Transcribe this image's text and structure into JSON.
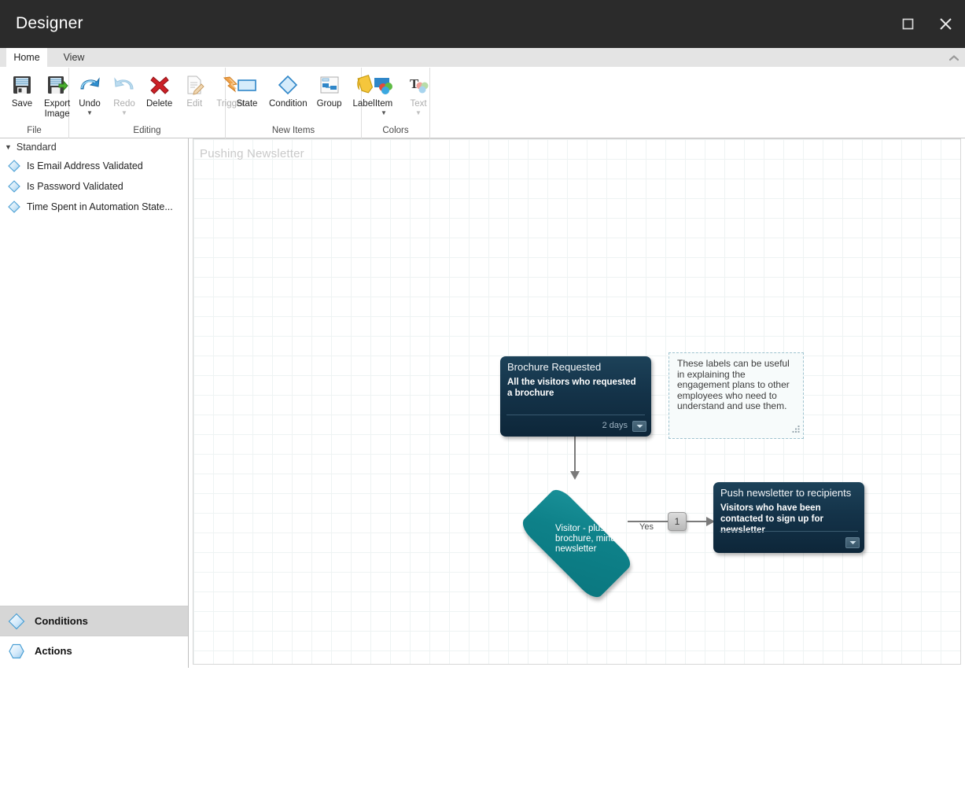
{
  "window": {
    "title": "Designer",
    "maximize_icon": "maximize-icon",
    "close_icon": "close-icon"
  },
  "ribbon": {
    "tabs": [
      {
        "label": "Home",
        "active": true
      },
      {
        "label": "View",
        "active": false
      }
    ],
    "collapse_icon": "chevron-up-icon",
    "groups": [
      {
        "name": "File",
        "label": "File",
        "items": [
          {
            "label": "Save",
            "icon": "floppy-disk-icon",
            "disabled": false,
            "has_caret": false
          },
          {
            "label": "Export\nImage",
            "icon": "floppy-export-icon",
            "disabled": false,
            "has_caret": false
          }
        ]
      },
      {
        "name": "Editing",
        "label": "Editing",
        "items": [
          {
            "label": "Undo",
            "icon": "undo-arrow-icon",
            "disabled": false,
            "has_caret": true
          },
          {
            "label": "Redo",
            "icon": "redo-arrow-icon",
            "disabled": true,
            "has_caret": true
          },
          {
            "label": "Delete",
            "icon": "red-x-icon",
            "disabled": false,
            "has_caret": false
          },
          {
            "label": "Edit",
            "icon": "pencil-page-icon",
            "disabled": true,
            "has_caret": false
          },
          {
            "label": "Trigger",
            "icon": "lightning-arrow-icon",
            "disabled": true,
            "has_caret": false
          }
        ]
      },
      {
        "name": "New Items",
        "label": "New Items",
        "items": [
          {
            "label": "State",
            "icon": "rectangle-icon",
            "disabled": false,
            "has_caret": false
          },
          {
            "label": "Condition",
            "icon": "diamond-icon",
            "disabled": false,
            "has_caret": false
          },
          {
            "label": "Group",
            "icon": "group-diagram-icon",
            "disabled": false,
            "has_caret": false
          },
          {
            "label": "Label",
            "icon": "tag-icon",
            "disabled": false,
            "has_caret": false
          }
        ]
      },
      {
        "name": "Colors",
        "label": "Colors",
        "items": [
          {
            "label": "Item",
            "icon": "item-color-icon",
            "disabled": false,
            "has_caret": true
          },
          {
            "label": "Text",
            "icon": "text-color-icon",
            "disabled": true,
            "has_caret": true
          }
        ]
      }
    ]
  },
  "left_panel": {
    "tree": {
      "header": "Standard",
      "expander_icon": "triangle-down-icon",
      "items": [
        {
          "label": "Is Email Address Validated",
          "icon": "condition-diamond-icon"
        },
        {
          "label": "Is Password Validated",
          "icon": "condition-diamond-icon"
        },
        {
          "label": "Time Spent in Automation State...",
          "icon": "condition-diamond-icon"
        }
      ]
    },
    "categories": [
      {
        "label": "Conditions",
        "icon": "condition-diamond-icon",
        "selected": true
      },
      {
        "label": "Actions",
        "icon": "action-hexagon-icon",
        "selected": false
      }
    ]
  },
  "canvas": {
    "title": "Pushing Newsletter",
    "nodes": [
      {
        "id": "brochure",
        "type": "state",
        "title": "Brochure Requested",
        "description": "All the visitors who requested a brochure",
        "footer": "2 days",
        "dropdown_icon": "chevron-down-icon"
      },
      {
        "id": "push",
        "type": "state",
        "title": "Push newsletter to recipients",
        "description": "Visitors who have been contacted to sign up for newsletter",
        "footer": "",
        "dropdown_icon": "chevron-down-icon"
      },
      {
        "id": "condition",
        "type": "condition",
        "text": "Visitor - plus brochure, minus newsletter"
      },
      {
        "id": "note",
        "type": "label",
        "text": "These labels can be useful in explaining the engagement plans to other employees who need to understand and use them.",
        "grip_icon": "resize-grip-icon"
      }
    ],
    "edges": [
      {
        "id": "edge-yes",
        "label": "Yes"
      }
    ],
    "junction": {
      "label": "1"
    }
  },
  "statusbar": {
    "zoom_slider": "zoom-slider",
    "fit_button_icon": "fit-to-screen-icon"
  },
  "colors": {
    "titlebar_bg": "#2b2b2b",
    "state_node": "#14334a",
    "condition_node": "#0e8189",
    "label_border": "#9fc3cf",
    "connector": "#7a7a7a"
  }
}
